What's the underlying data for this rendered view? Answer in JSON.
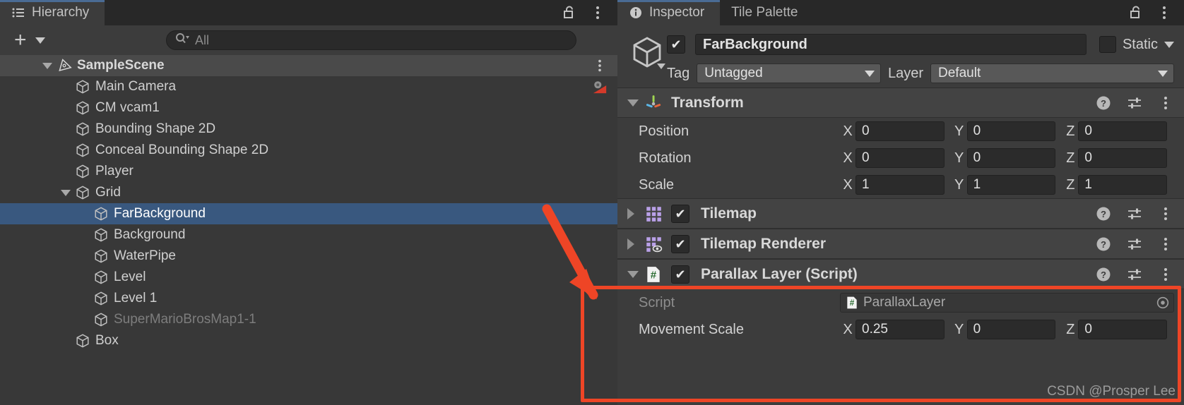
{
  "hierarchy": {
    "tab_label": "Hierarchy",
    "tab_icon": "hierarchy-icon",
    "lock_icon": "unlocked-padlock-icon",
    "menu_icon": "kebab-menu-icon",
    "create_button": "+",
    "create_dropdown_icon": "caret-down-icon",
    "search": {
      "placeholder": "All",
      "value": "",
      "icon": "search-icon"
    },
    "items": [
      {
        "label": "SampleScene",
        "depth": 0,
        "expanded": true,
        "selected": false,
        "dim": false,
        "scene": true,
        "icon": "unity-scene-icon",
        "right_icon": "kebab-menu-icon"
      },
      {
        "label": "Main Camera",
        "depth": 1,
        "expanded": null,
        "selected": false,
        "dim": false,
        "scene": false,
        "icon": "gameobject-cube-icon",
        "right_icon": "cinemachine-gear-icon"
      },
      {
        "label": "CM vcam1",
        "depth": 1,
        "expanded": null,
        "selected": false,
        "dim": false,
        "scene": false,
        "icon": "gameobject-cube-icon",
        "right_icon": ""
      },
      {
        "label": "Bounding Shape 2D",
        "depth": 1,
        "expanded": null,
        "selected": false,
        "dim": false,
        "scene": false,
        "icon": "gameobject-cube-icon",
        "right_icon": ""
      },
      {
        "label": "Conceal Bounding Shape 2D",
        "depth": 1,
        "expanded": null,
        "selected": false,
        "dim": false,
        "scene": false,
        "icon": "gameobject-cube-icon",
        "right_icon": ""
      },
      {
        "label": "Player",
        "depth": 1,
        "expanded": null,
        "selected": false,
        "dim": false,
        "scene": false,
        "icon": "gameobject-cube-icon",
        "right_icon": ""
      },
      {
        "label": "Grid",
        "depth": 1,
        "expanded": true,
        "selected": false,
        "dim": false,
        "scene": false,
        "icon": "gameobject-cube-icon",
        "right_icon": ""
      },
      {
        "label": "FarBackground",
        "depth": 2,
        "expanded": null,
        "selected": true,
        "dim": false,
        "scene": false,
        "icon": "gameobject-cube-icon",
        "right_icon": ""
      },
      {
        "label": "Background",
        "depth": 2,
        "expanded": null,
        "selected": false,
        "dim": false,
        "scene": false,
        "icon": "gameobject-cube-icon",
        "right_icon": ""
      },
      {
        "label": "WaterPipe",
        "depth": 2,
        "expanded": null,
        "selected": false,
        "dim": false,
        "scene": false,
        "icon": "gameobject-cube-icon",
        "right_icon": ""
      },
      {
        "label": "Level",
        "depth": 2,
        "expanded": null,
        "selected": false,
        "dim": false,
        "scene": false,
        "icon": "gameobject-cube-icon",
        "right_icon": ""
      },
      {
        "label": "Level 1",
        "depth": 2,
        "expanded": null,
        "selected": false,
        "dim": false,
        "scene": false,
        "icon": "gameobject-cube-icon",
        "right_icon": ""
      },
      {
        "label": "SuperMarioBrosMap1-1",
        "depth": 2,
        "expanded": null,
        "selected": false,
        "dim": true,
        "scene": false,
        "icon": "gameobject-cube-icon",
        "right_icon": ""
      },
      {
        "label": "Box",
        "depth": 1,
        "expanded": null,
        "selected": false,
        "dim": false,
        "scene": false,
        "icon": "gameobject-cube-icon",
        "right_icon": ""
      }
    ]
  },
  "inspector": {
    "tabs": [
      {
        "label": "Inspector",
        "active": true,
        "icon": "info-circle-icon"
      },
      {
        "label": "Tile Palette",
        "active": false,
        "icon": ""
      }
    ],
    "lock_icon": "unlocked-padlock-icon",
    "menu_icon": "kebab-menu-icon",
    "object": {
      "icon": "gameobject-cube-icon",
      "enabled": true,
      "name": "FarBackground",
      "static_label": "Static",
      "static_checked": false,
      "tag_label": "Tag",
      "tag_value": "Untagged",
      "layer_label": "Layer",
      "layer_value": "Default"
    },
    "components": [
      {
        "title": "Transform",
        "icon": "transform-axis-icon",
        "expanded": true,
        "has_enable_checkbox": false,
        "enabled": true,
        "actions": [
          "help-icon",
          "preset-sliders-icon",
          "kebab-menu-icon"
        ],
        "properties": [
          {
            "label": "Position",
            "type": "vector3",
            "x": "0",
            "y": "0",
            "z": "0"
          },
          {
            "label": "Rotation",
            "type": "vector3",
            "x": "0",
            "y": "0",
            "z": "0"
          },
          {
            "label": "Scale",
            "type": "vector3",
            "x": "1",
            "y": "1",
            "z": "1"
          }
        ]
      },
      {
        "title": "Tilemap",
        "icon": "tilemap-grid-icon",
        "expanded": false,
        "has_enable_checkbox": true,
        "enabled": true,
        "actions": [
          "help-icon",
          "preset-sliders-icon",
          "kebab-menu-icon"
        ],
        "properties": []
      },
      {
        "title": "Tilemap Renderer",
        "icon": "tilemap-renderer-icon",
        "expanded": false,
        "has_enable_checkbox": true,
        "enabled": true,
        "actions": [
          "help-icon",
          "preset-sliders-icon",
          "kebab-menu-icon"
        ],
        "properties": []
      },
      {
        "title": "Parallax Layer (Script)",
        "icon": "csharp-script-icon",
        "expanded": true,
        "has_enable_checkbox": true,
        "enabled": true,
        "actions": [
          "help-icon",
          "preset-sliders-icon",
          "kebab-menu-icon"
        ],
        "properties": [
          {
            "label": "Script",
            "type": "object",
            "value": "ParallaxLayer",
            "icon": "csharp-script-icon",
            "picker_icon": "object-picker-icon"
          },
          {
            "label": "Movement Scale",
            "type": "vector3",
            "x": "0.25",
            "y": "0",
            "z": "0"
          }
        ]
      }
    ]
  },
  "annotations": {
    "highlight_box_color": "#ee4526",
    "arrow_color": "#ee4526",
    "arrow_name": "red-annotation-arrow",
    "watermark": "CSDN @Prosper Lee"
  },
  "colors": {
    "selection_blue": "#39587f",
    "panel_bg": "#3c3c3c",
    "header_bg": "#434343",
    "window_bg": "#282828",
    "accent_red": "#ee4526"
  }
}
